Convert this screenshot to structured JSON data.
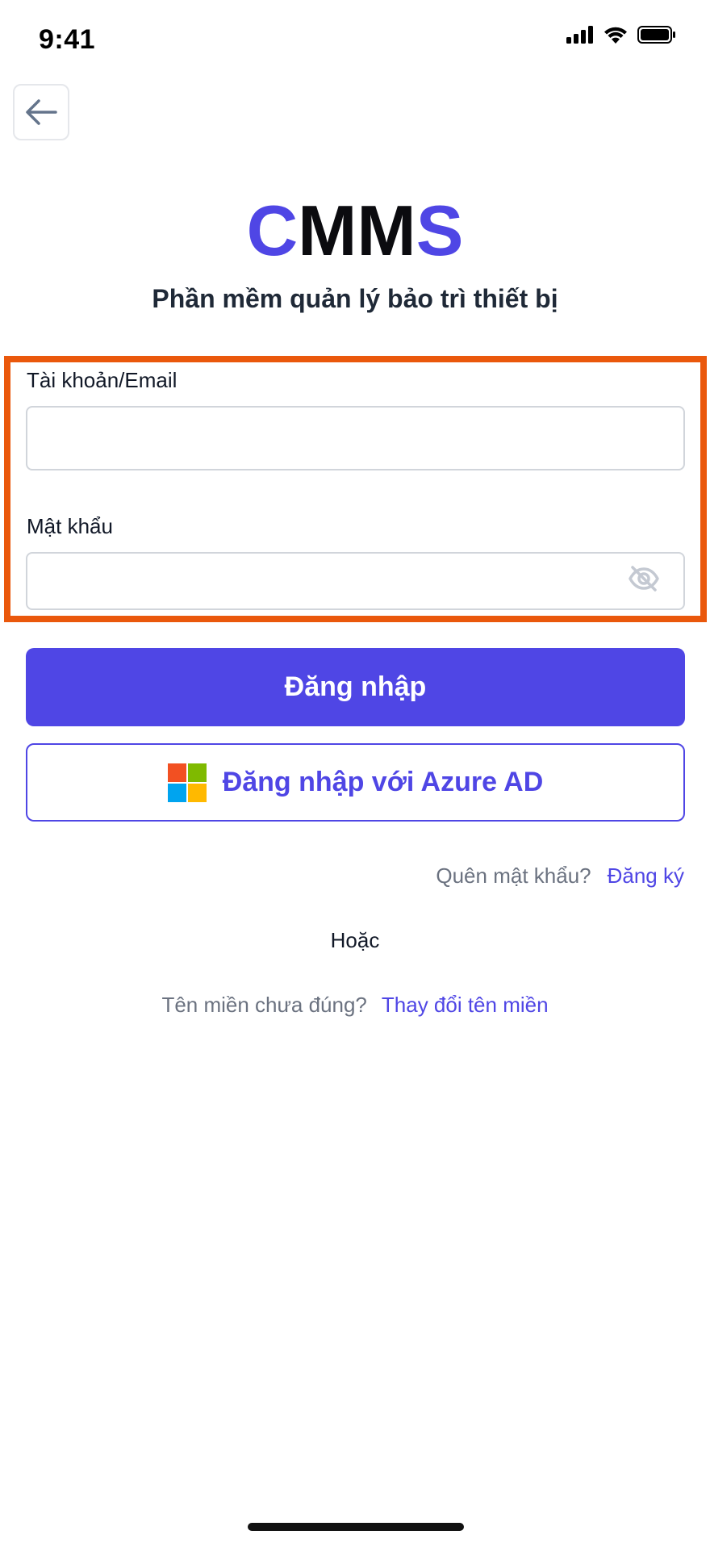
{
  "status_bar": {
    "time": "9:41"
  },
  "header": {
    "back_icon": "arrow-left-icon"
  },
  "logo": {
    "part1": "C",
    "part2": "MM",
    "part3": "S"
  },
  "subtitle": "Phần mềm quản lý bảo trì thiết bị",
  "form": {
    "account_label": "Tài khoản/Email",
    "account_value": "",
    "password_label": "Mật khẩu",
    "password_value": "",
    "password_toggle_icon": "eye-off-icon"
  },
  "buttons": {
    "login": "Đăng nhập",
    "azure_login": "Đăng nhập với Azure AD",
    "azure_icon": "microsoft-logo-icon"
  },
  "links": {
    "forgot_password": "Quên mật khẩu?",
    "register": "Đăng ký",
    "or": "Hoặc",
    "wrong_domain": "Tên miền chưa đúng?",
    "change_domain": "Thay đổi tên miền"
  },
  "colors": {
    "accent": "#4f46e5",
    "highlight": "#ea580c",
    "ms_red": "#f25022",
    "ms_green": "#7fba00",
    "ms_blue": "#00a4ef",
    "ms_yellow": "#ffb900"
  }
}
